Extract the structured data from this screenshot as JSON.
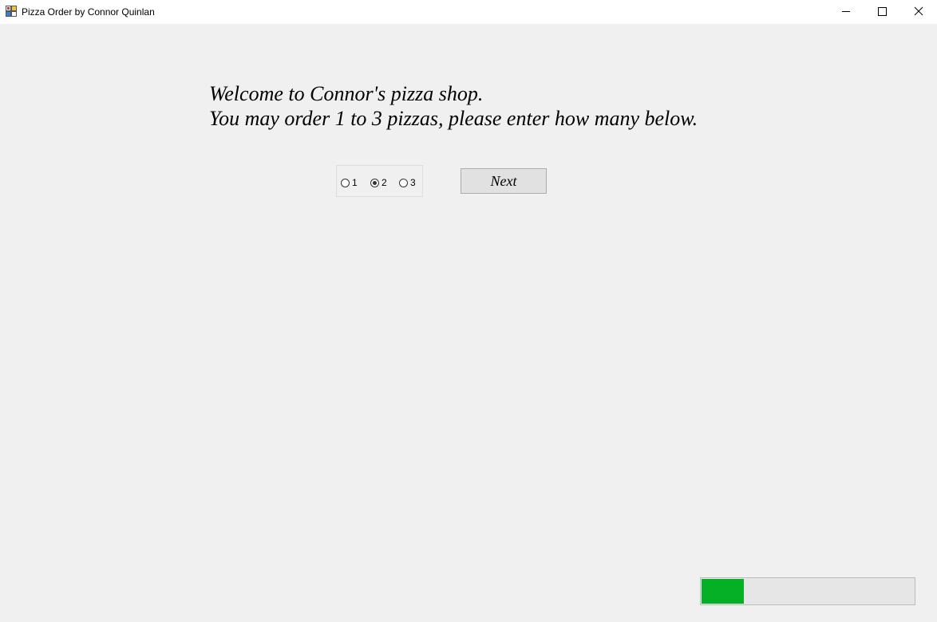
{
  "window": {
    "title": "Pizza Order by Connor Quinlan",
    "app_icon": "winforms-app-icon",
    "controls": [
      "minimize-icon",
      "maximize-icon",
      "close-icon"
    ]
  },
  "welcome": {
    "line1": "Welcome to Connor's pizza shop.",
    "line2": "You may order 1 to 3 pizzas, please enter how many below."
  },
  "pizza_count": {
    "options": [
      "1",
      "2",
      "3"
    ],
    "selected": "2"
  },
  "next_button": {
    "label": "Next"
  },
  "progress": {
    "value_percent": 20,
    "fill_color": "#06b025"
  }
}
